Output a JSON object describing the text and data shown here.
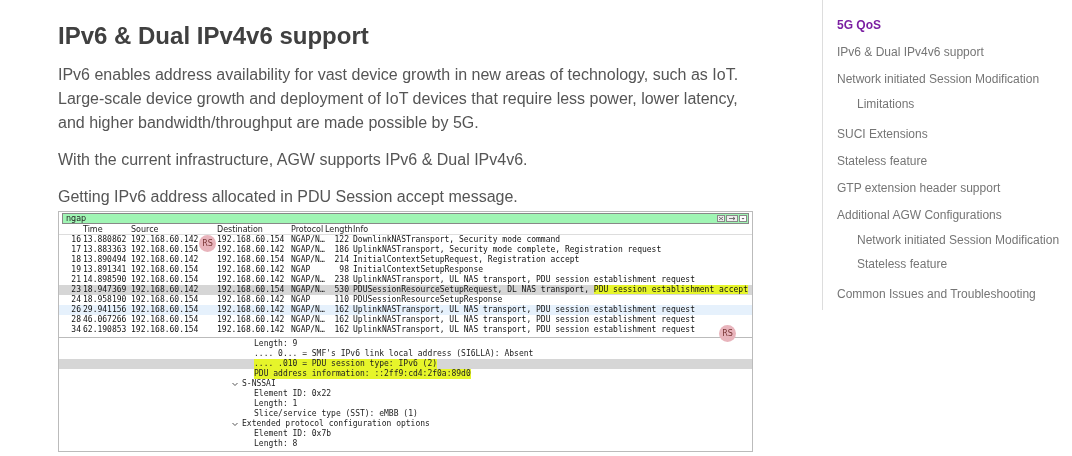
{
  "article": {
    "heading": "IPv6 & Dual IPv4v6 support",
    "paragraphs": [
      "IPv6 enables address availability for vast device growth in new areas of technology, such as IoT. Large-scale device growth and deployment of IoT devices that require less power, lower latency, and higher bandwidth/throughput are made possible by 5G.",
      "With the current infrastructure, AGW supports IPv6 & Dual IPv4v6.",
      "Getting IPv6 address allocated in PDU Session accept message."
    ]
  },
  "capture": {
    "filter": {
      "value": "ngap"
    },
    "columns": [
      "Time",
      "Source",
      "Destination",
      "Protocol",
      "Length",
      "Info"
    ],
    "rows": [
      {
        "no": "16",
        "time": "13.880862",
        "source": "192.168.60.142",
        "destination": "192.168.60.154",
        "protocol": "NGAP/N…",
        "length": "122",
        "info": "DownlinkNASTransport, Security mode command",
        "selected": false,
        "hovered": false
      },
      {
        "no": "17",
        "time": "13.883363",
        "source": "192.168.60.154",
        "destination": "192.168.60.142",
        "protocol": "NGAP/N…",
        "length": "186",
        "info": "UplinkNASTransport, Security mode complete, Registration request",
        "selected": false,
        "hovered": false
      },
      {
        "no": "18",
        "time": "13.890494",
        "source": "192.168.60.142",
        "destination": "192.168.60.154",
        "protocol": "NGAP/N…",
        "length": "214",
        "info": "InitialContextSetupRequest, Registration accept",
        "selected": false,
        "hovered": false
      },
      {
        "no": "19",
        "time": "13.891341",
        "source": "192.168.60.154",
        "destination": "192.168.60.142",
        "protocol": "NGAP",
        "length": "98",
        "info": "InitialContextSetupResponse",
        "selected": false,
        "hovered": false
      },
      {
        "no": "21",
        "time": "14.898590",
        "source": "192.168.60.154",
        "destination": "192.168.60.142",
        "protocol": "NGAP/N…",
        "length": "238",
        "info": "UplinkNASTransport, UL NAS transport, PDU session establishment request",
        "selected": false,
        "hovered": false
      },
      {
        "no": "23",
        "time": "18.947369",
        "source": "192.168.60.142",
        "destination": "192.168.60.154",
        "protocol": "NGAP/N…",
        "length": "530",
        "info": "PDUSessionResourceSetupRequest, DL NAS transport, ",
        "info_highlight": "PDU session establishment accept",
        "selected": true,
        "hovered": false
      },
      {
        "no": "24",
        "time": "18.958190",
        "source": "192.168.60.154",
        "destination": "192.168.60.142",
        "protocol": "NGAP",
        "length": "110",
        "info": "PDUSessionResourceSetupResponse",
        "selected": false,
        "hovered": false
      },
      {
        "no": "26",
        "time": "29.941156",
        "source": "192.168.60.154",
        "destination": "192.168.60.142",
        "protocol": "NGAP/N…",
        "length": "162",
        "info": "UplinkNASTransport, UL NAS transport, PDU session establishment request",
        "selected": false,
        "hovered": true
      },
      {
        "no": "28",
        "time": "46.067266",
        "source": "192.168.60.154",
        "destination": "192.168.60.142",
        "protocol": "NGAP/N…",
        "length": "162",
        "info": "UplinkNASTransport, UL NAS transport, PDU session establishment request",
        "selected": false,
        "hovered": false
      },
      {
        "no": "34",
        "time": "62.190853",
        "source": "192.168.60.154",
        "destination": "192.168.60.142",
        "protocol": "NGAP/N…",
        "length": "162",
        "info": "UplinkNASTransport, UL NAS transport, PDU session establishment request",
        "selected": false,
        "hovered": false
      }
    ],
    "badges": [
      "RS",
      "RS"
    ],
    "details": [
      {
        "children": [
          {
            "text": "Length: 9",
            "selected": false,
            "highlighted": false
          },
          {
            "text": ".... 0... = SMF's IPv6 link local address (SI6LLA): Absent",
            "selected": false,
            "highlighted": false
          },
          {
            "text": ".... .010 = PDU session type: IPv6 (2)",
            "selected": true,
            "highlighted": true
          },
          {
            "text": "PDU address information: ::2ff9:cd4:2f0a:89d0",
            "selected": false,
            "highlighted": true
          }
        ]
      },
      {
        "text": "S-NSSAI",
        "expanded": true,
        "children": [
          {
            "text": "Element ID: 0x22",
            "selected": false,
            "highlighted": false
          },
          {
            "text": "Length: 1",
            "selected": false,
            "highlighted": false
          },
          {
            "text": "Slice/service type (SST): eMBB (1)",
            "selected": false,
            "highlighted": false
          }
        ]
      },
      {
        "text": "Extended protocol configuration options",
        "expanded": true,
        "children": [
          {
            "text": "Element ID: 0x7b",
            "selected": false,
            "highlighted": false
          },
          {
            "text": "Length: 8",
            "selected": false,
            "highlighted": false
          }
        ]
      }
    ]
  },
  "toc": [
    {
      "label": "5G QoS",
      "selected": true
    },
    {
      "label": "IPv6 & Dual IPv4v6 support",
      "selected": false
    },
    {
      "label": "Network initiated Session Modification",
      "selected": false,
      "children": [
        {
          "label": "Limitations",
          "selected": false
        }
      ]
    },
    {
      "label": "SUCI Extensions",
      "selected": false
    },
    {
      "label": "Stateless feature",
      "selected": false
    },
    {
      "label": "GTP extension header support",
      "selected": false
    },
    {
      "label": "Additional AGW Configurations",
      "selected": false,
      "children": [
        {
          "label": "Network initiated Session Modification",
          "selected": false
        },
        {
          "label": "Stateless feature",
          "selected": false
        }
      ]
    },
    {
      "label": "Common Issues and Troubleshooting",
      "selected": false
    }
  ]
}
